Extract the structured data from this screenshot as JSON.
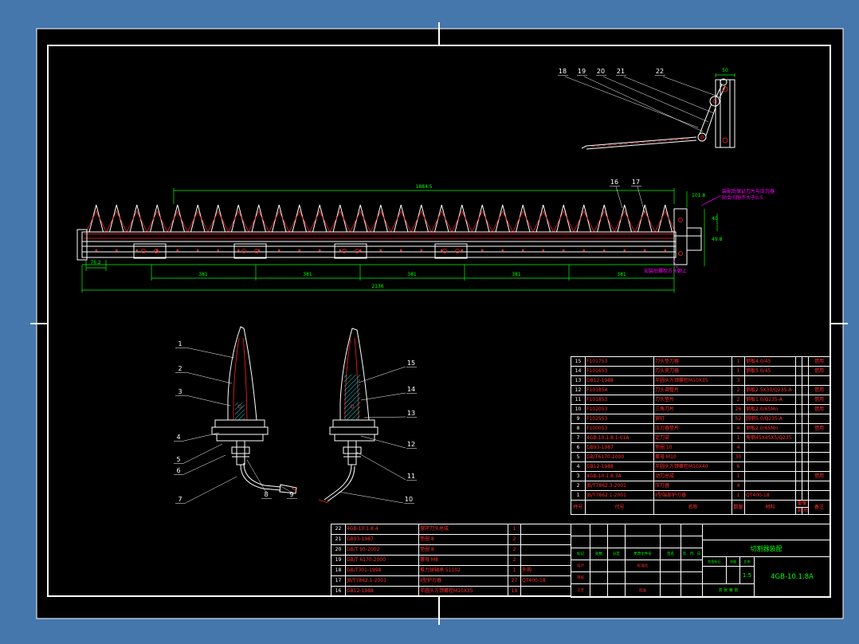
{
  "drawing": {
    "title": "切割器装配",
    "number": "4GB-10.1.8A",
    "scale": "1:5",
    "sheets": "共 张 第 张"
  },
  "title_block": {
    "labels": {
      "mark": "标记",
      "count": "处数",
      "zone": "分区",
      "change_file": "更改文件号",
      "sign": "签名",
      "date": "年、月、日",
      "design": "设计",
      "check": "审核",
      "process": "工艺",
      "standard": "标准化",
      "approve": "批准",
      "stage": "阶段标记",
      "weight": "质量",
      "scale_label": "比例"
    }
  },
  "bom_right": {
    "header": {
      "no": "件号",
      "code": "代号",
      "name": "名称",
      "qty": "数量",
      "material": "材料",
      "weight": "重量",
      "unit": "单件",
      "total": "总计",
      "remark": "备注"
    },
    "rows": [
      {
        "no": "15",
        "code": "F101753",
        "name": "刀头垫刀器",
        "qty": "1",
        "material": "钢板4.0/45",
        "remark": "借用"
      },
      {
        "no": "14",
        "code": "F101653",
        "name": "刀头夹刀器",
        "qty": "1",
        "material": "钢板5.0/45",
        "remark": "借用"
      },
      {
        "no": "13",
        "code": "GB12-1988",
        "name": "半圆头方颈螺栓M10X35",
        "qty": "3",
        "material": "",
        "remark": ""
      },
      {
        "no": "12",
        "code": "F101854",
        "name": "刀头调整片",
        "qty": "2",
        "material": "钢板2.5X30/Q235-A",
        "remark": "借用"
      },
      {
        "no": "11",
        "code": "F101853",
        "name": "刀头垫片",
        "qty": "2",
        "material": "钢板1.0/Q235-A",
        "remark": "借用"
      },
      {
        "no": "10",
        "code": "F102053",
        "name": "三角刀片",
        "qty": "26",
        "material": "钢板2.0/65Mn",
        "remark": "借用"
      },
      {
        "no": "9",
        "code": "F102553",
        "name": "铆钉",
        "qty": "52",
        "material": "圆钢5.0/Q235-A",
        "remark": ""
      },
      {
        "no": "8",
        "code": "F100053",
        "name": "压刃器垫片",
        "qty": "4",
        "material": "钢板2.0/65Mn",
        "remark": "借用"
      },
      {
        "no": "7",
        "code": "4GB-10.1.8.1-01A",
        "name": "定刀梁",
        "qty": "1",
        "material": "角钢45X45X5/Q235",
        "remark": ""
      },
      {
        "no": "6",
        "code": "GB93-1987",
        "name": "垫圈 10",
        "qty": "4",
        "material": "",
        "remark": ""
      },
      {
        "no": "5",
        "code": "GB/T6170-2000",
        "name": "螺母 M10",
        "qty": "30",
        "material": "",
        "remark": ""
      },
      {
        "no": "4",
        "code": "GB12-1988",
        "name": "半圆头方颈螺栓M10X40",
        "qty": "6",
        "material": "",
        "remark": ""
      },
      {
        "no": "3",
        "code": "4GB-10.1.8.3A",
        "name": "动刀总成",
        "qty": "1",
        "material": "",
        "remark": "借用"
      },
      {
        "no": "2",
        "code": "JB/T7862.3-2001",
        "name": "压刃器",
        "qty": "4",
        "material": "",
        "remark": ""
      },
      {
        "no": "1",
        "code": "JB/T7862.1-2001",
        "name": "Ⅱ型端部护刃器",
        "qty": "1",
        "material": "QT400-18",
        "remark": ""
      }
    ]
  },
  "bom_left": {
    "rows": [
      {
        "no": "22",
        "code": "4GB-10.1.8.4",
        "name": "摆环刀头总成",
        "qty": "1",
        "material": ""
      },
      {
        "no": "21",
        "code": "GB93-1987",
        "name": "垫圈 8",
        "qty": "2",
        "material": ""
      },
      {
        "no": "20",
        "code": "GB/T 95-2002",
        "name": "垫圈 8",
        "qty": "2",
        "material": ""
      },
      {
        "no": "19",
        "code": "GB/T 6170-2000",
        "name": "螺母 M8",
        "qty": "2",
        "material": ""
      },
      {
        "no": "18",
        "code": "GB/T301-1998",
        "name": "推力球轴承 51102",
        "qty": "1",
        "material": "外购"
      },
      {
        "no": "17",
        "code": "JB/T7862.1-2001",
        "name": "Ⅱ型护刃器",
        "qty": "27",
        "material": "QT400-18"
      },
      {
        "no": "16",
        "code": "GB12-1988",
        "name": "半圆头方颈螺栓M10X35",
        "qty": "19",
        "material": ""
      }
    ]
  },
  "main_view": {
    "leaders": [
      "16",
      "17"
    ],
    "dims": {
      "top": "1884.5",
      "left": "76.2",
      "segments": [
        "381",
        "381",
        "381",
        "381",
        "381"
      ],
      "total": "2136",
      "r1": "101.8",
      "r2": "40",
      "r3": "49.8"
    },
    "notes": {
      "n1a": "装配后保证刀片与压刃器",
      "n1b": "贴合间隙不大于0.5",
      "n2": "安装后螺栓方头朝上"
    }
  },
  "top_detail": {
    "leaders": [
      "18",
      "19",
      "20",
      "21",
      "22"
    ],
    "dim": "50"
  },
  "detail_left": {
    "leaders": [
      "1",
      "2",
      "3",
      "4",
      "5",
      "6",
      "7",
      "8",
      "9"
    ]
  },
  "detail_right": {
    "leaders": [
      "15",
      "14",
      "13",
      "12",
      "11",
      "10"
    ]
  },
  "colors": {
    "background": "#4577ad",
    "paper": "#000000",
    "line": "#ffffff",
    "dimension": "#00ff00",
    "part": "#ff2020",
    "hatch": "#00e5e5",
    "note": "#ff00ff"
  }
}
